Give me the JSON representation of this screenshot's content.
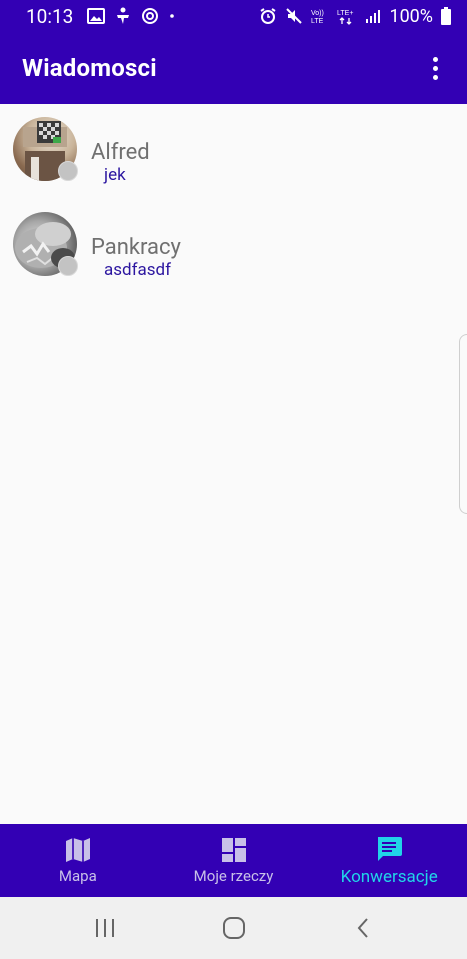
{
  "status_bar": {
    "time": "10:13",
    "battery": "100%"
  },
  "app_bar": {
    "title": "Wiadomosci"
  },
  "conversations": [
    {
      "name": "Alfred",
      "last_message": "jek"
    },
    {
      "name": "Pankracy",
      "last_message": "asdfasdf"
    }
  ],
  "bottom_nav": {
    "items": [
      {
        "label": "Mapa",
        "icon": "map-icon",
        "active": false
      },
      {
        "label": "Moje rzeczy",
        "icon": "dashboard-icon",
        "active": false
      },
      {
        "label": "Konwersacje",
        "icon": "chat-icon",
        "active": true
      }
    ]
  },
  "colors": {
    "primary": "#3300b4",
    "accent": "#21d4e8",
    "message_text": "#2c16a0",
    "name_text": "#707070"
  }
}
